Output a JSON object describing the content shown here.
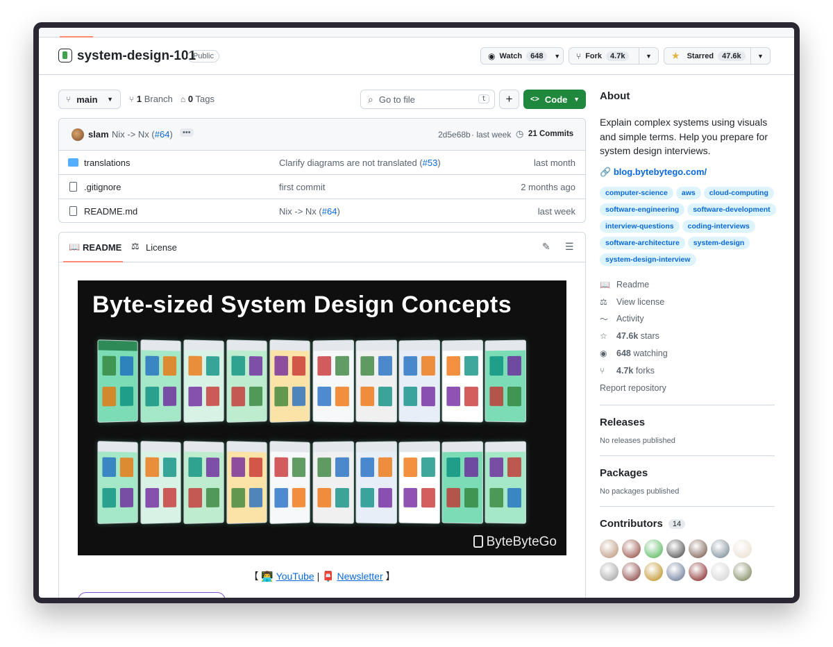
{
  "repo": {
    "name": "system-design-101",
    "visibility": "Public",
    "watch": {
      "label": "Watch",
      "count": "648"
    },
    "fork": {
      "label": "Fork",
      "count": "4.7k"
    },
    "star": {
      "label": "Starred",
      "count": "47.6k"
    }
  },
  "toolbar": {
    "branch": "main",
    "branches_count": "1",
    "branches_label": "Branch",
    "tags_count": "0",
    "tags_label": "Tags",
    "search_placeholder": "Go to file",
    "search_key": "t",
    "add_label": "+",
    "code_label": "Code"
  },
  "latest_commit": {
    "author": "slam",
    "message": "Nix -> Nx (",
    "pr": "#64",
    "close": ")",
    "hash": "2d5e68b",
    "time": "· last week",
    "commits_label": "21 Commits"
  },
  "files": [
    {
      "name": "translations",
      "type": "folder",
      "message": "Clarify diagrams are not translated (",
      "pr": "#53",
      "close": ")",
      "date": "last month"
    },
    {
      "name": ".gitignore",
      "type": "file",
      "message": "first commit",
      "pr": "",
      "close": "",
      "date": "2 months ago"
    },
    {
      "name": "README.md",
      "type": "file",
      "message": "Nix -> Nx (",
      "pr": "#64",
      "close": ")",
      "date": "last week"
    }
  ],
  "readme": {
    "tab_readme": "README",
    "tab_license": "License",
    "banner_title": "Byte-sized System Design Concepts",
    "banner_logo": "ByteByteGo",
    "links": {
      "open": "【",
      "youtube": "YouTube",
      "sep": "|",
      "newsletter": "Newsletter",
      "close": "】"
    }
  },
  "about": {
    "heading": "About",
    "description": "Explain complex systems using visuals and simple terms. Help you prepare for system design interviews.",
    "website": "blog.bytebytego.com/",
    "topics": [
      "computer-science",
      "aws",
      "cloud-computing",
      "software-engineering",
      "software-development",
      "interview-questions",
      "coding-interviews",
      "software-architecture",
      "system-design",
      "system-design-interview"
    ],
    "stats": {
      "readme": "Readme",
      "license": "View license",
      "activity": "Activity",
      "stars_count": "47.6k",
      "stars_label": "stars",
      "watching_count": "648",
      "watching_label": "watching",
      "forks_count": "4.7k",
      "forks_label": "forks",
      "report": "Report repository"
    }
  },
  "releases": {
    "heading": "Releases",
    "text": "No releases published"
  },
  "packages": {
    "heading": "Packages",
    "text": "No packages published"
  },
  "contributors": {
    "heading": "Contributors",
    "count": "14",
    "avatar_colors": [
      "#b38b6d",
      "#8a3b2f",
      "#44b04a",
      "#3a3a3a",
      "#6b4a3a",
      "#6c7f8c",
      "#e8dccd",
      "#9a9a9a",
      "#7a2e2a",
      "#b8860b",
      "#5a6b8c",
      "#7a1010",
      "#cfcfcf",
      "#6f7a4a"
    ]
  }
}
